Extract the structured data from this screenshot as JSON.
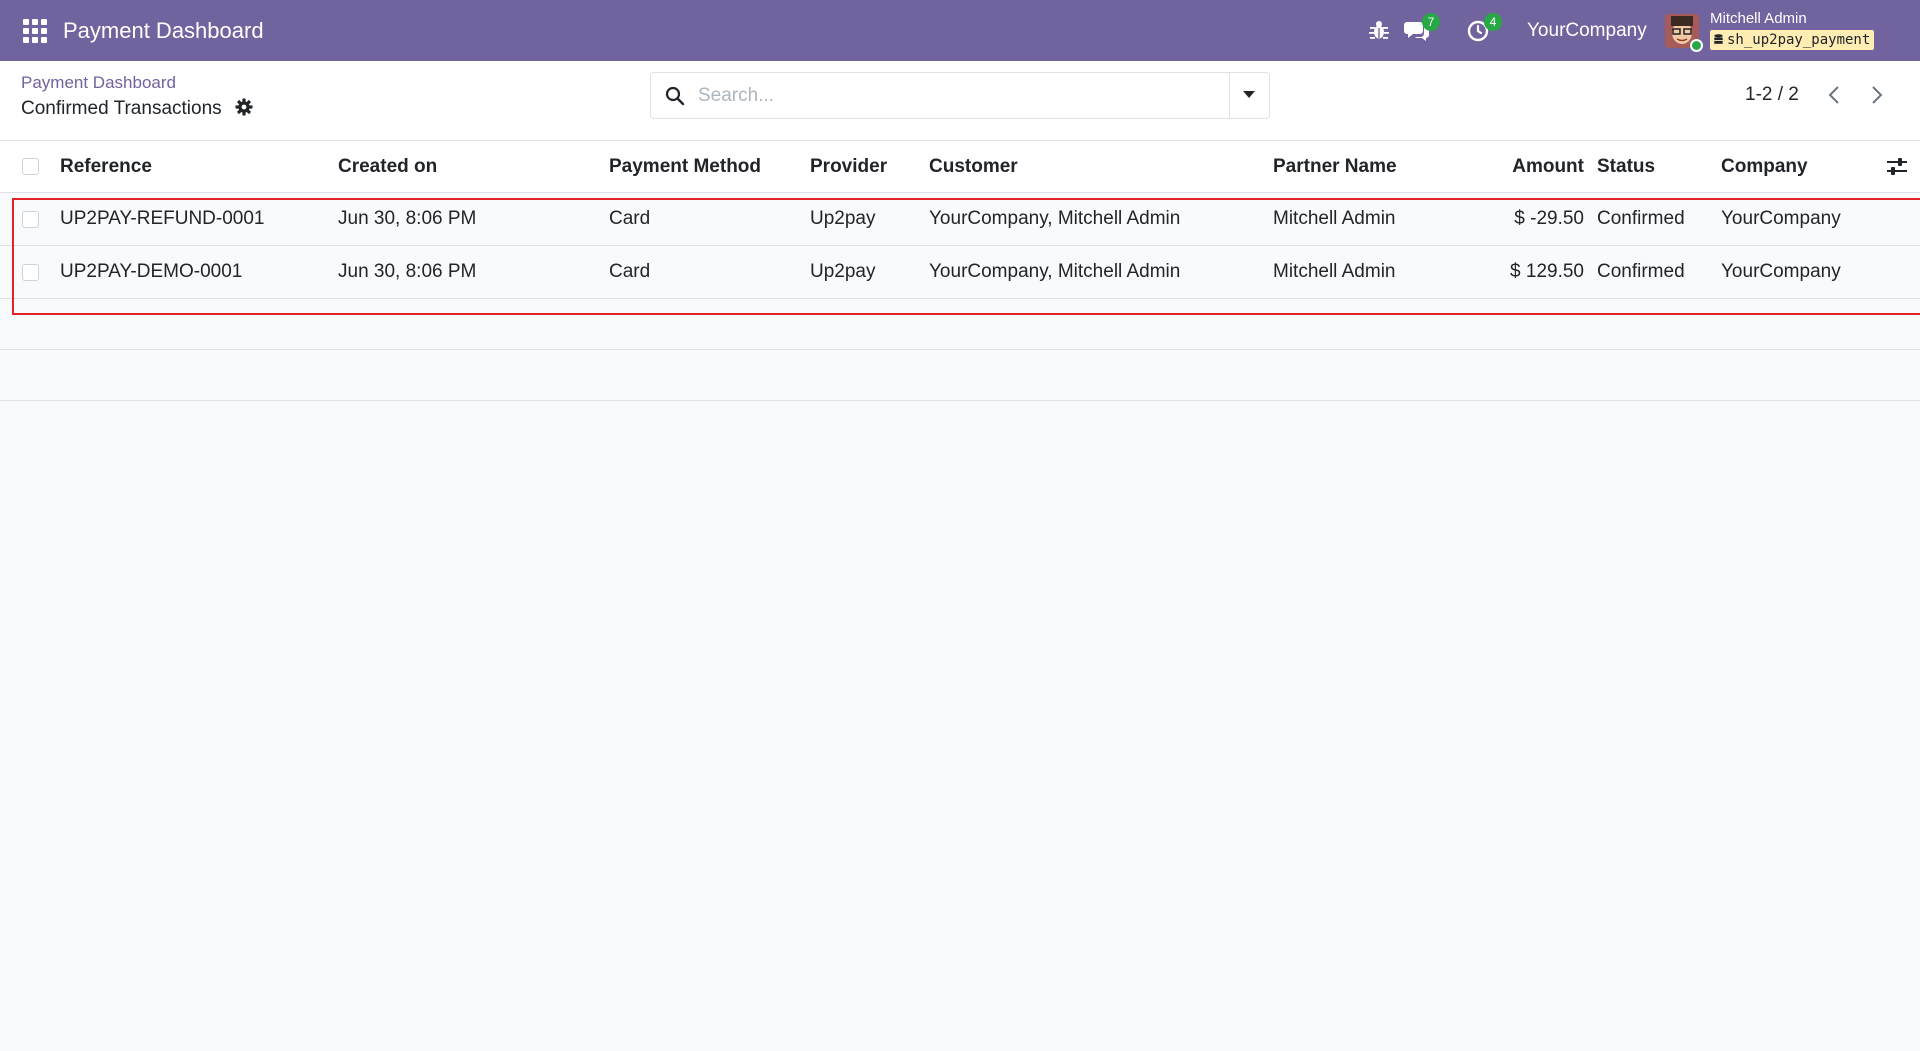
{
  "navbar": {
    "app_title": "Payment Dashboard",
    "messages_count": "7",
    "activities_count": "4",
    "company": "YourCompany",
    "user_name": "Mitchell Admin",
    "database": "sh_up2pay_payment"
  },
  "control_panel": {
    "breadcrumb_parent": "Payment Dashboard",
    "breadcrumb_current": "Confirmed Transactions",
    "search_placeholder": "Search...",
    "pager_value": "1-2 / 2"
  },
  "table": {
    "columns": [
      "Reference",
      "Created on",
      "Payment Method",
      "Provider",
      "Customer",
      "Partner Name",
      "Amount",
      "Status",
      "Company"
    ],
    "rows": [
      {
        "reference": "UP2PAY-REFUND-0001",
        "created_on": "Jun 30, 8:06 PM",
        "payment_method": "Card",
        "provider": "Up2pay",
        "customer": "YourCompany, Mitchell Admin",
        "partner_name": "Mitchell Admin",
        "amount": "$ -29.50",
        "status": "Confirmed",
        "company": "YourCompany"
      },
      {
        "reference": "UP2PAY-DEMO-0001",
        "created_on": "Jun 30, 8:06 PM",
        "payment_method": "Card",
        "provider": "Up2pay",
        "customer": "YourCompany, Mitchell Admin",
        "partner_name": "Mitchell Admin",
        "amount": "$ 129.50",
        "status": "Confirmed",
        "company": "YourCompany"
      }
    ]
  },
  "colors": {
    "brand": "#71639e",
    "badge": "#28a745",
    "highlight": "#e8202a",
    "db_badge": "#ffedb3"
  },
  "icons": [
    "apps-grid-icon",
    "bug-icon",
    "chat-icon",
    "activity-clock-icon",
    "gear-icon",
    "search-icon",
    "caret-down-icon",
    "chevron-left-icon",
    "chevron-right-icon",
    "optional-columns-icon",
    "database-icon"
  ]
}
